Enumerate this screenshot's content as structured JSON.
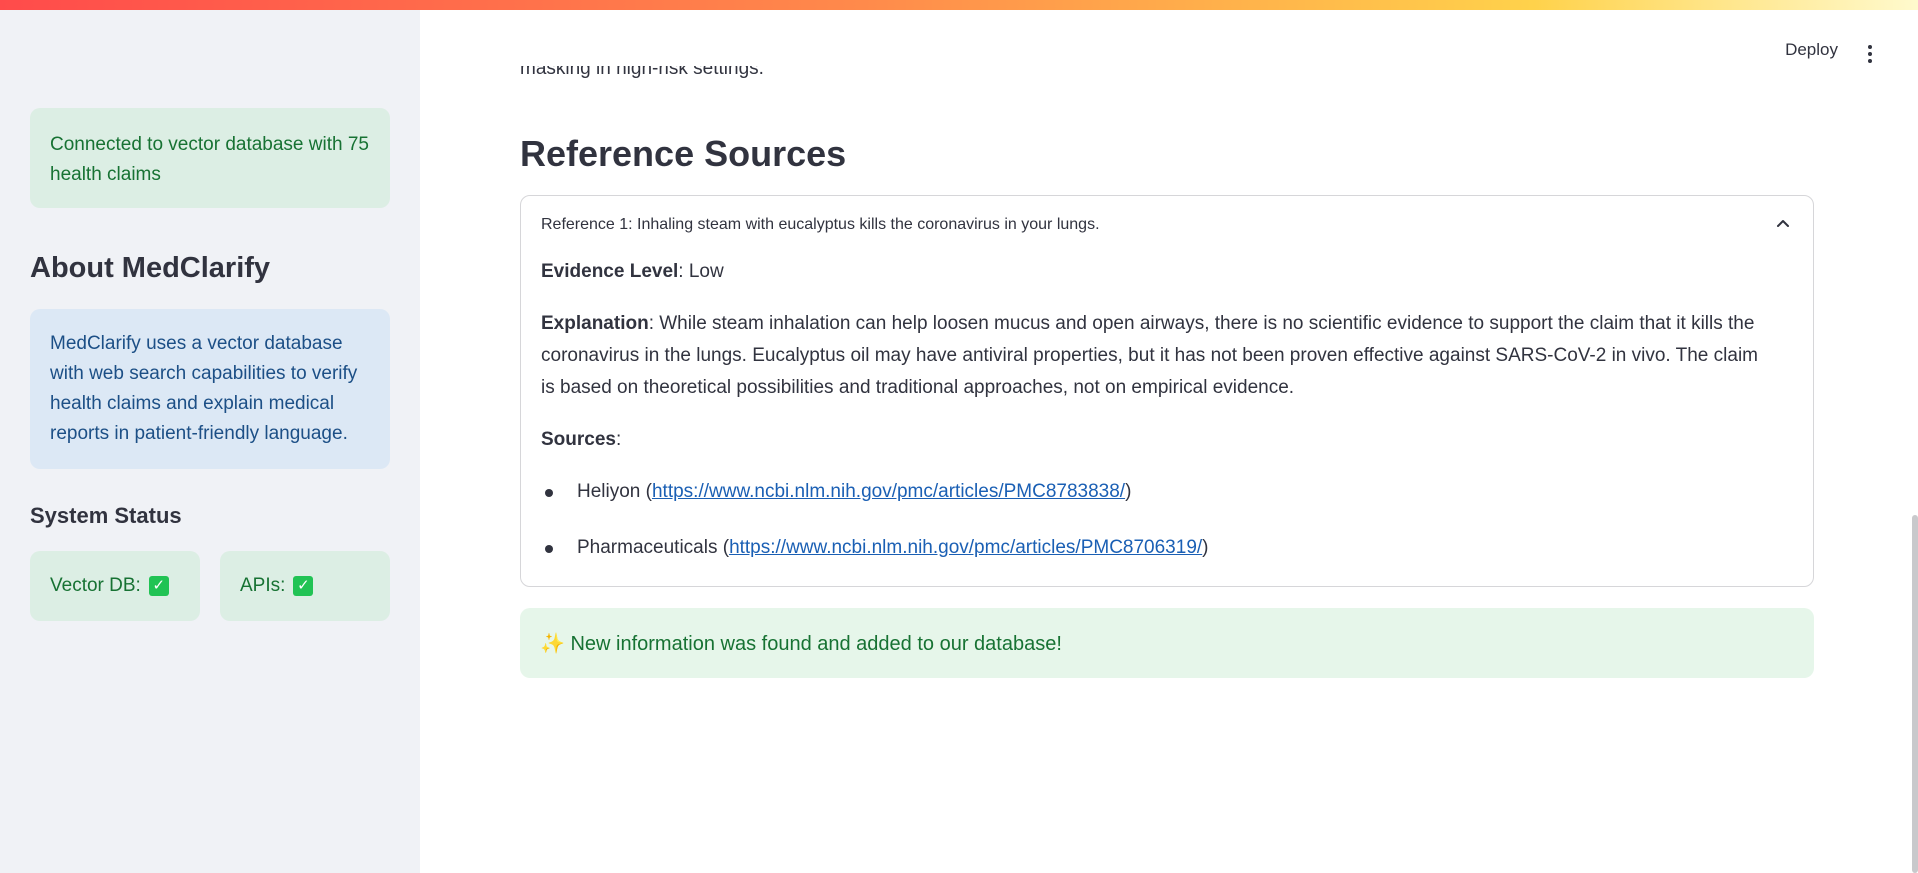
{
  "sidebar": {
    "db_status": "Connected to vector database with 75 health claims",
    "about_title": "About MedClarify",
    "about_text": "MedClarify uses a vector database with web search capabilities to verify health claims and explain medical reports in patient-friendly language.",
    "system_status_title": "System Status",
    "vector_db_label": "Vector DB:",
    "apis_label": "APIs:",
    "check_glyph": "✓"
  },
  "header": {
    "deploy_label": "Deploy",
    "menu_icon": "kebab-icon"
  },
  "main": {
    "cut_off_text": "masking in high-risk settings.",
    "section_title": "Reference Sources",
    "expander": {
      "title": "Reference 1: Inhaling steam with eucalyptus kills the coronavirus in your lungs.",
      "evidence_label": "Evidence Level",
      "evidence_value": ": Low",
      "explanation_label": "Explanation",
      "explanation_text": ": While steam inhalation can help loosen mucus and open airways, there is no scientific evidence to support the claim that it kills the coronavirus in the lungs. Eucalyptus oil may have antiviral properties, but it has not been proven effective against SARS-CoV-2 in vivo. The claim is based on theoretical possibilities and traditional approaches, not on empirical evidence.",
      "sources_label": "Sources",
      "sources_colon": ":",
      "sources": [
        {
          "name": "Heliyon (",
          "url": "https://www.ncbi.nlm.nih.gov/pmc/articles/PMC8783838/",
          "close": ")"
        },
        {
          "name": "Pharmaceuticals (",
          "url": "https://www.ncbi.nlm.nih.gov/pmc/articles/PMC8706319/",
          "close": ")"
        }
      ]
    },
    "success_message": "✨ New information was found and added to our database!"
  },
  "colors": {
    "success_bg": "#dceee4",
    "success_text": "#177233",
    "info_bg": "#dce8f5",
    "info_text": "#1c4f86",
    "link": "#1a5fb4"
  }
}
